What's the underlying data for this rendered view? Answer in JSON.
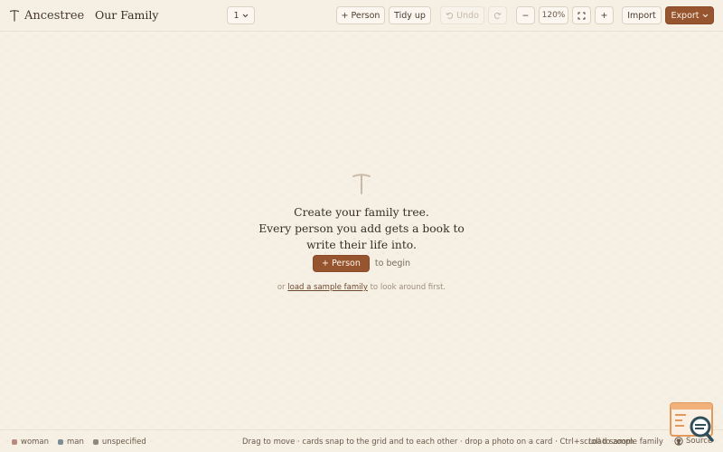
{
  "app": {
    "name": "Ancestree",
    "tree_name": "Our Family"
  },
  "toolbar": {
    "generation_select": "1",
    "add_person": "+ Person",
    "tidy_up": "Tidy up",
    "undo": "Undo",
    "zoom_out": "−",
    "zoom_level": "120%",
    "zoom_in": "+",
    "import": "Import",
    "export": "Export"
  },
  "empty_state": {
    "headline_line1": "Create your family tree.",
    "headline_line2": "Every person you add gets a book to",
    "headline_line3": "write their life into.",
    "cta": "+ Person",
    "after_cta": "to begin",
    "sub_prefix": "or",
    "sub_link": "load a sample family",
    "sub_suffix": "to look around first."
  },
  "footer": {
    "legend": [
      {
        "label": "woman",
        "color": "#b8897c"
      },
      {
        "label": "man",
        "color": "#7d8e96"
      },
      {
        "label": "unspecified",
        "color": "#8e8a7a"
      }
    ],
    "hint": "Drag to move · cards snap to the grid and to each other · drop a photo on a card · Ctrl+scroll to zoom",
    "load_sample": "Load sample family",
    "source": "Source"
  },
  "colors": {
    "background": "#f5efe4",
    "accent": "#96542f",
    "text": "#4a3b2e"
  }
}
